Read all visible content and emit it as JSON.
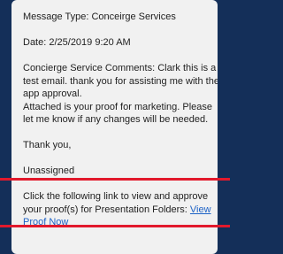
{
  "message": {
    "type_line": "Message Type: Conceirge Services",
    "date_line": "Date: 2/25/2019 9:20 AM",
    "comments_line1": "Concierge Service Comments: Clark this is a",
    "comments_line2": "test email. thank you for assisting me with the",
    "comments_line3": "app approval.",
    "attached_line1": "Attached is your proof for marketing. Please",
    "attached_line2": "let me know if any changes will be needed.",
    "thanks": "Thank you,",
    "assignee": "Unassigned",
    "link_prompt": "Click the following link to view and approve your proof(s) for Presentation Folders: ",
    "link_text": "View Proof Now"
  },
  "colors": {
    "background": "#142f59",
    "card": "#f1f1f1",
    "link": "#1e63c6",
    "highlight": "#e2192c"
  }
}
